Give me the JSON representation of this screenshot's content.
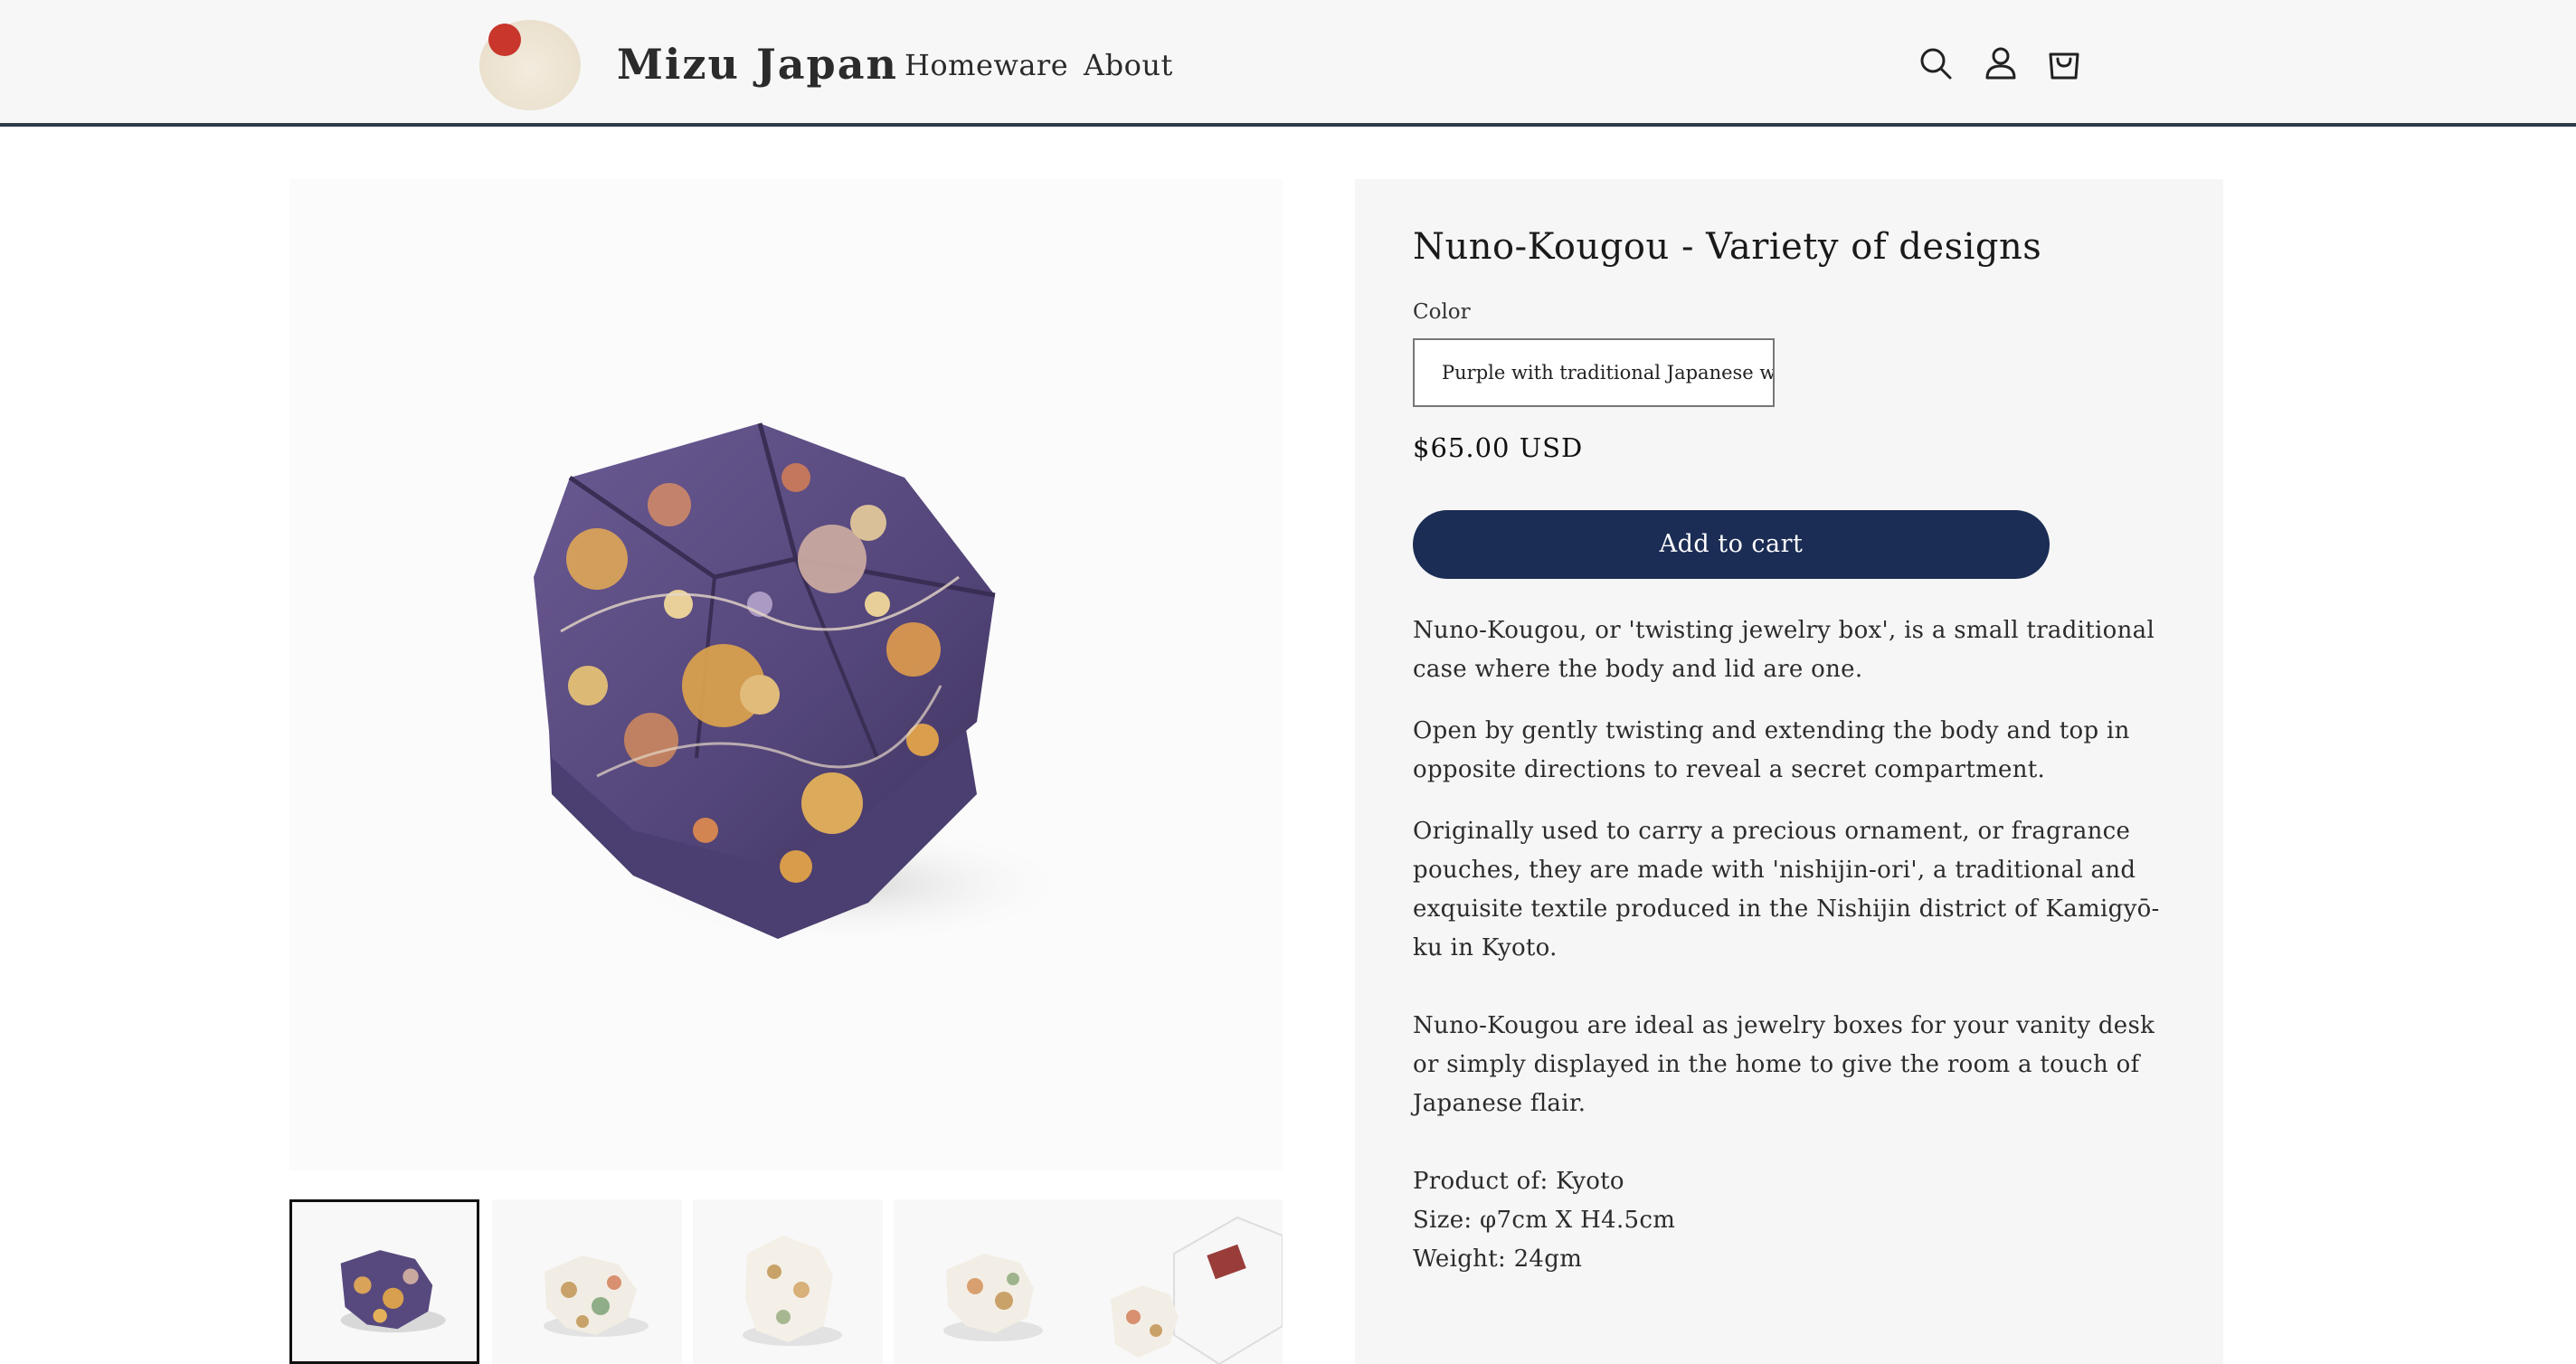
{
  "header": {
    "brand": "Mizu Japan",
    "nav": [
      {
        "label": "Homeware"
      },
      {
        "label": "About"
      }
    ],
    "icons": [
      "search-icon",
      "account-icon",
      "cart-icon"
    ],
    "accent_color": "#c8362c",
    "border_color": "#2f3b4c"
  },
  "gallery": {
    "thumbnails": [
      {
        "name": "purple"
      },
      {
        "name": "white-floral-1"
      },
      {
        "name": "white-floral-2"
      },
      {
        "name": "white-floral-3"
      },
      {
        "name": "white-with-box"
      }
    ],
    "active_index": 0
  },
  "product": {
    "title": "Nuno-Kougou - Variety of designs",
    "color_label": "Color",
    "color_selected": "Purple with traditional Japanese w",
    "price": "$65.00 USD",
    "add_to_cart": "Add to cart",
    "button_color": "#1b2d55",
    "description": [
      "Nuno-Kougou, or 'twisting jewelry box', is a small traditional case where the body and lid are one.",
      "Open by gently twisting and extending the body and top in opposite directions to reveal a secret compartment.",
      "Originally used to carry a precious ornament, or fragrance pouches, they are made with 'nishijin-ori', a traditional and exquisite textile produced in the Nishijin district of Kamigyō-ku in Kyoto.",
      "Nuno-Kougou are ideal as jewelry boxes for your vanity desk or simply displayed in the home to give the room a touch of Japanese flair."
    ],
    "specs": {
      "origin": "Product of: Kyoto",
      "size": "Size: φ7cm X H4.5cm",
      "weight": "Weight: 24gm"
    }
  }
}
